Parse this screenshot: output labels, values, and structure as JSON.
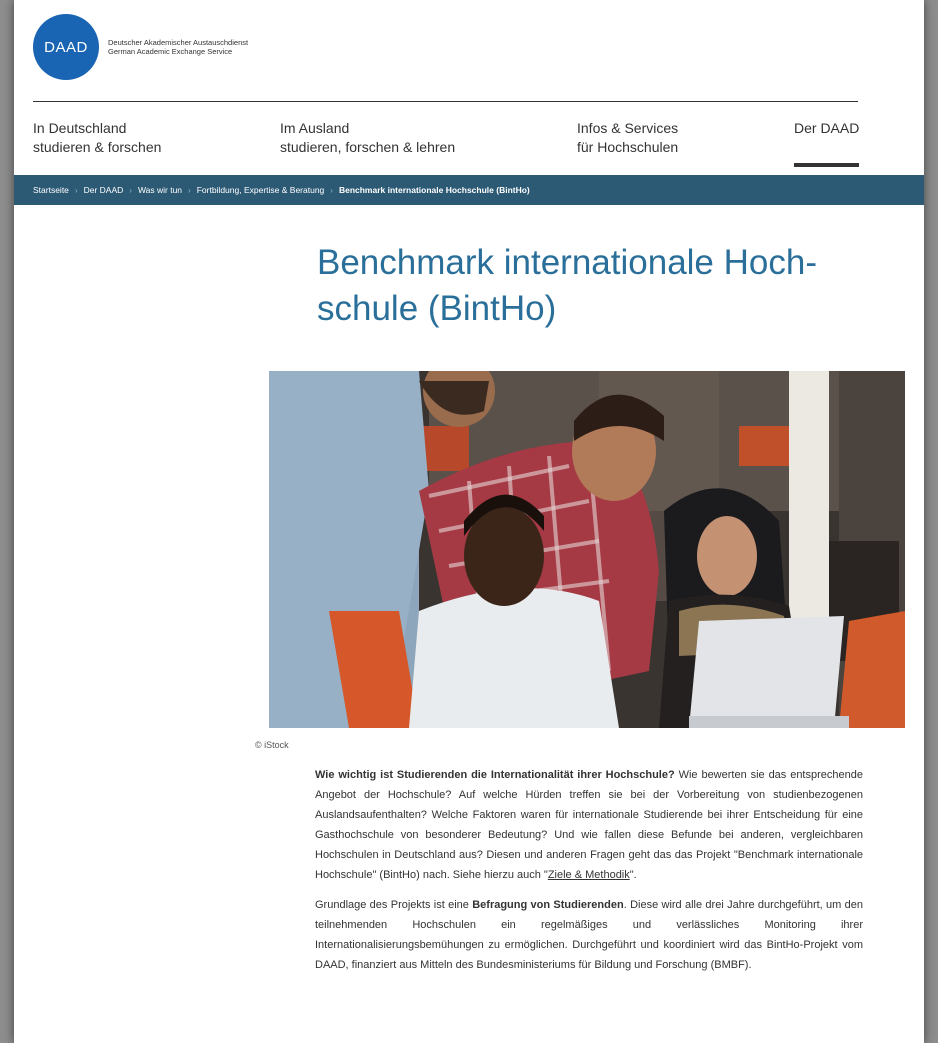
{
  "header": {
    "logo_text": "DAAD",
    "org_name_de": "Deutscher Akademischer Austauschdienst",
    "org_name_en": "German Academic Exchange Service"
  },
  "nav": {
    "items": [
      {
        "line1": "In Deutschland",
        "line2": "studieren & forschen"
      },
      {
        "line1": "Im Ausland",
        "line2": "studieren, forschen & lehren"
      },
      {
        "line1": "Infos & Services",
        "line2": "für Hochschulen"
      },
      {
        "line1": "Der DAAD",
        "line2": ""
      }
    ]
  },
  "breadcrumb": {
    "items": [
      "Startseite",
      "Der DAAD",
      "Was wir tun",
      "Fortbildung, Expertise & Beratung"
    ],
    "current": "Benchmark internationale Hochschule (BintHo)"
  },
  "page": {
    "title_line1": "Benchmark internationale Hoch-",
    "title_line2": "schule (BintHo)"
  },
  "image": {
    "credit": "© iStock"
  },
  "article": {
    "p1_bold": "Wie wichtig ist Studierenden die Internationalität ihrer Hochschule?",
    "p1_text": " Wie bewerten sie das entsprechende Angebot der Hochschule? Auf welche Hürden treffen sie bei der Vorbereitung von studienbezogenen Auslandsaufenthalten? Welche Faktoren waren für internationale Studierende bei ihrer Entscheidung für eine Gasthochschule von besonderer Bedeutung? Und wie fallen diese Befunde bei anderen, vergleichbaren Hochschulen in Deutschland aus? Diesen und anderen Fragen geht das das Projekt \"Benchmark internationale Hochschule\" (BintHo) nach. Siehe hierzu auch \"",
    "p1_link": "Ziele & Methodik",
    "p1_end": "\".",
    "p2_start": "Grundlage des Projekts ist eine ",
    "p2_bold": "Befragung von Studierenden",
    "p2_text": ". Diese wird alle drei Jahre durchgeführt, um den teilnehmenden Hochschulen ein regelmäßiges und verlässliches Monitoring ihrer Internationalisierungsbemühungen zu ermöglichen. Durchgeführt und koordiniert wird das BintHo-Projekt vom DAAD, finanziert aus Mitteln des Bundesministeriums für Bildung und Forschung (BMBF)."
  },
  "colors": {
    "brand_blue": "#1a64b4",
    "breadcrumb_bg": "#2c5a75",
    "title_blue": "#2a6f9a"
  }
}
